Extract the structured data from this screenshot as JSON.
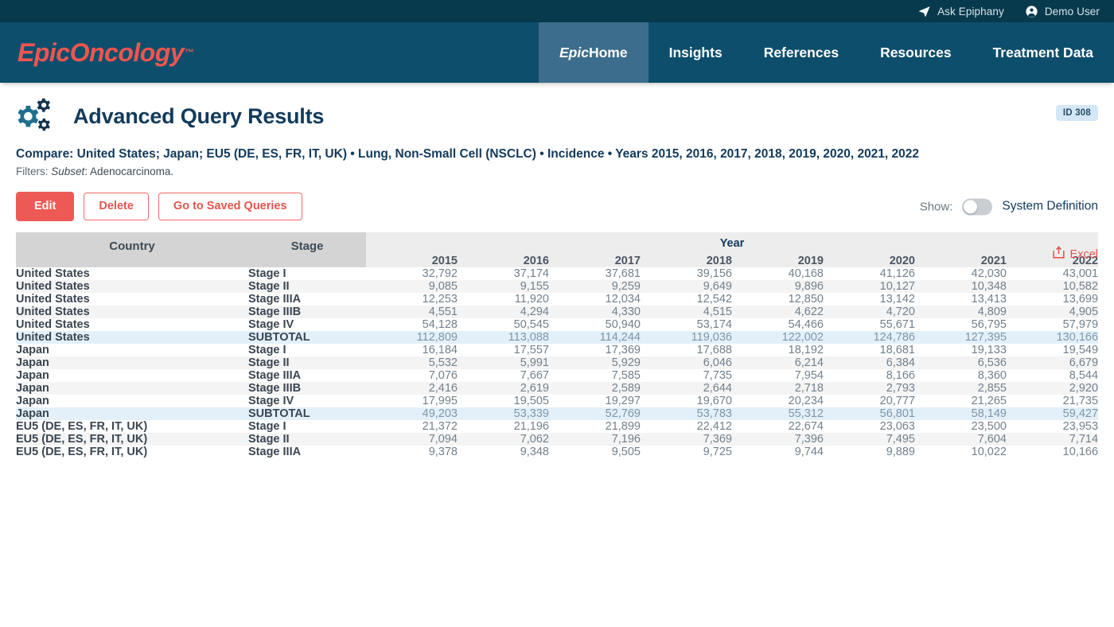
{
  "utilbar": {
    "items": [
      {
        "label": "Ask Epiphany",
        "icon": "paper-plane-icon"
      },
      {
        "label": "Demo User",
        "icon": "user-circle-icon"
      }
    ]
  },
  "brand": {
    "name": "EpicOncology",
    "tm": "™"
  },
  "nav": {
    "tabs": [
      {
        "label_italic": "Epic",
        "label": " Home",
        "active": true
      },
      {
        "label_italic": "",
        "label": "Insights",
        "active": false
      },
      {
        "label_italic": "",
        "label": "References",
        "active": false
      },
      {
        "label_italic": "",
        "label": "Resources",
        "active": false
      },
      {
        "label_italic": "",
        "label": "Treatment Data",
        "active": false
      }
    ]
  },
  "header": {
    "title": "Advanced Query Results",
    "id_badge": "ID 308",
    "compare_text": "Compare: United States; Japan; EU5 (DE, ES, FR, IT, UK) • Lung, Non-Small Cell (NSCLC) • Incidence • Years 2015, 2016, 2017, 2018, 2019, 2020, 2021, 2022",
    "filters_label": "Filters:",
    "filters_em": "Subset",
    "filters_value": ": Adenocarcinoma.",
    "excel_label": "Excel"
  },
  "actions": {
    "edit_label": "Edit",
    "delete_label": "Delete",
    "saved_queries_label": "Go to Saved Queries",
    "show_label": "Show:",
    "toggle_label": "System Definition",
    "toggle_on": false
  },
  "colors": {
    "brand_red": "#f2554f",
    "nav_blue": "#0d4e6c",
    "nav_active": "#3d6d8c",
    "utilbar": "#083a4d",
    "title_navy": "#123a5c",
    "badge_bg": "#d3e7f7",
    "subtotal_row": "#e3f0fa"
  },
  "chart_data": {
    "type": "table",
    "title": "Advanced Query Results",
    "group_header": "Year",
    "columns": [
      "Country",
      "Stage",
      "2015",
      "2016",
      "2017",
      "2018",
      "2019",
      "2020",
      "2021",
      "2022"
    ],
    "rows": [
      {
        "country": "United States",
        "stage": "Stage I",
        "values": [
          "32,792",
          "37,174",
          "37,681",
          "39,156",
          "40,168",
          "41,126",
          "42,030",
          "43,001"
        ],
        "kind": "data"
      },
      {
        "country": "United States",
        "stage": "Stage II",
        "values": [
          "9,085",
          "9,155",
          "9,259",
          "9,649",
          "9,896",
          "10,127",
          "10,348",
          "10,582"
        ],
        "kind": "data"
      },
      {
        "country": "United States",
        "stage": "Stage IIIA",
        "values": [
          "12,253",
          "11,920",
          "12,034",
          "12,542",
          "12,850",
          "13,142",
          "13,413",
          "13,699"
        ],
        "kind": "data"
      },
      {
        "country": "United States",
        "stage": "Stage IIIB",
        "values": [
          "4,551",
          "4,294",
          "4,330",
          "4,515",
          "4,622",
          "4,720",
          "4,809",
          "4,905"
        ],
        "kind": "data"
      },
      {
        "country": "United States",
        "stage": "Stage IV",
        "values": [
          "54,128",
          "50,545",
          "50,940",
          "53,174",
          "54,466",
          "55,671",
          "56,795",
          "57,979"
        ],
        "kind": "data"
      },
      {
        "country": "United States",
        "stage": "SUBTOTAL",
        "values": [
          "112,809",
          "113,088",
          "114,244",
          "119,036",
          "122,002",
          "124,786",
          "127,395",
          "130,166"
        ],
        "kind": "subtotal"
      },
      {
        "country": "Japan",
        "stage": "Stage I",
        "values": [
          "16,184",
          "17,557",
          "17,369",
          "17,688",
          "18,192",
          "18,681",
          "19,133",
          "19,549"
        ],
        "kind": "data"
      },
      {
        "country": "Japan",
        "stage": "Stage II",
        "values": [
          "5,532",
          "5,991",
          "5,929",
          "6,046",
          "6,214",
          "6,384",
          "6,536",
          "6,679"
        ],
        "kind": "data"
      },
      {
        "country": "Japan",
        "stage": "Stage IIIA",
        "values": [
          "7,076",
          "7,667",
          "7,585",
          "7,735",
          "7,954",
          "8,166",
          "8,360",
          "8,544"
        ],
        "kind": "data"
      },
      {
        "country": "Japan",
        "stage": "Stage IIIB",
        "values": [
          "2,416",
          "2,619",
          "2,589",
          "2,644",
          "2,718",
          "2,793",
          "2,855",
          "2,920"
        ],
        "kind": "data"
      },
      {
        "country": "Japan",
        "stage": "Stage IV",
        "values": [
          "17,995",
          "19,505",
          "19,297",
          "19,670",
          "20,234",
          "20,777",
          "21,265",
          "21,735"
        ],
        "kind": "data"
      },
      {
        "country": "Japan",
        "stage": "SUBTOTAL",
        "values": [
          "49,203",
          "53,339",
          "52,769",
          "53,783",
          "55,312",
          "56,801",
          "58,149",
          "59,427"
        ],
        "kind": "subtotal"
      },
      {
        "country": "EU5 (DE, ES, FR, IT, UK)",
        "stage": "Stage I",
        "values": [
          "21,372",
          "21,196",
          "21,899",
          "22,412",
          "22,674",
          "23,063",
          "23,500",
          "23,953"
        ],
        "kind": "data"
      },
      {
        "country": "EU5 (DE, ES, FR, IT, UK)",
        "stage": "Stage II",
        "values": [
          "7,094",
          "7,062",
          "7,196",
          "7,369",
          "7,396",
          "7,495",
          "7,604",
          "7,714"
        ],
        "kind": "data"
      },
      {
        "country": "EU5 (DE, ES, FR, IT, UK)",
        "stage": "Stage IIIA",
        "values": [
          "9,378",
          "9,348",
          "9,505",
          "9,725",
          "9,744",
          "9,889",
          "10,022",
          "10,166"
        ],
        "kind": "data"
      }
    ]
  }
}
